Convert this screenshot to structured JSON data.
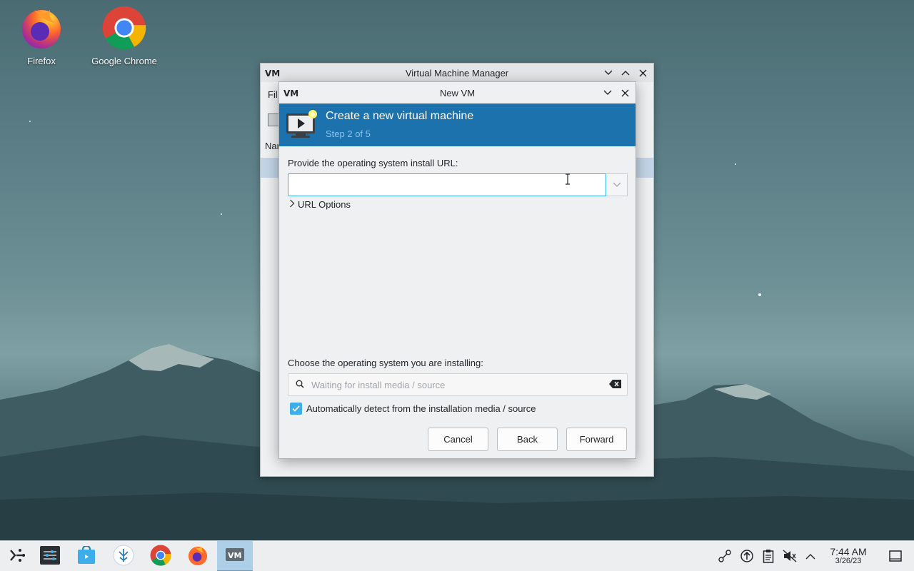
{
  "desktop": {
    "icons": [
      {
        "label": "Firefox",
        "icon": "firefox-icon"
      },
      {
        "label": "Google Chrome",
        "icon": "chrome-icon"
      }
    ]
  },
  "vmm_window": {
    "title": "Virtual Machine Manager",
    "menu_peek": "Fil",
    "column_peek": "Nar"
  },
  "dialog": {
    "title": "New VM",
    "banner_title": "Create a new virtual machine",
    "banner_step": "Step 2 of 5",
    "url_label": "Provide the operating system install URL:",
    "url_value": "",
    "url_options_label": "URL Options",
    "os_label": "Choose the operating system you are installing:",
    "os_search_placeholder": "Waiting for install media / source",
    "auto_detect_label": "Automatically detect from the installation media / source",
    "auto_detect_checked": true,
    "buttons": {
      "cancel": "Cancel",
      "back": "Back",
      "forward": "Forward"
    }
  },
  "taskbar": {
    "apps": [
      "launcher-icon",
      "settings-icon",
      "discover-icon",
      "virt-icon",
      "chrome-icon",
      "firefox-icon",
      "virt-manager-icon"
    ],
    "active_app": "virt-manager-icon",
    "tray": [
      "network-icon",
      "updates-icon",
      "clipboard-icon",
      "volume-muted-icon",
      "tray-expand-icon"
    ],
    "time": "7:44 AM",
    "date": "3/26/23"
  },
  "colors": {
    "accent": "#3daee9",
    "banner": "#1c72ad",
    "banner_step_text": "#8fc3ea"
  }
}
